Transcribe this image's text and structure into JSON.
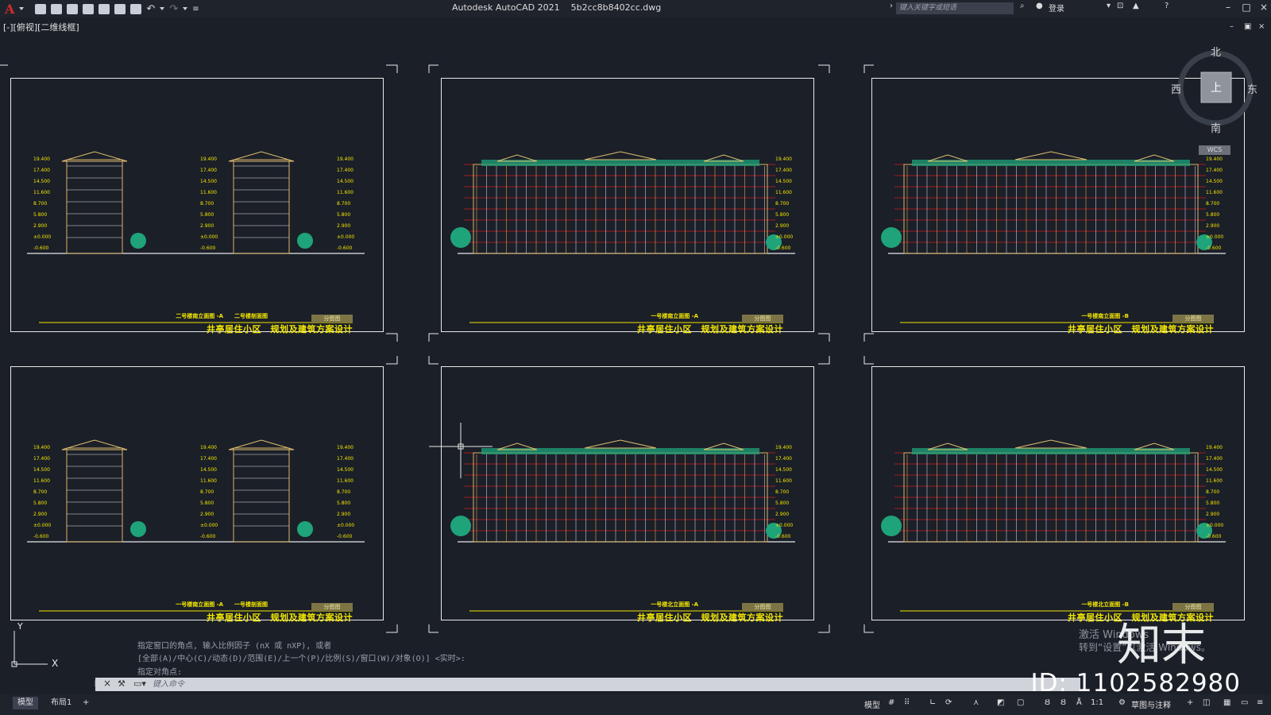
{
  "app": {
    "title": "Autodesk AutoCAD 2021",
    "filename": "5b2cc8b8402cc.dwg",
    "logo": "A"
  },
  "search": {
    "placeholder": "键入关键字或短语"
  },
  "account": {
    "login": "登录"
  },
  "viewport": {
    "label": "[-][俯视][二维线框]"
  },
  "sheets": [
    {
      "project": "井亭居住小区　规划及建筑方案设计",
      "caption": "二号楼南立面图 -A　　二号楼剖面图",
      "badge": "分图图",
      "levels": [
        "19.400",
        "17.400",
        "14.500",
        "11.600",
        "8.700",
        "5.800",
        "2.900",
        "±0.000",
        "-0.600"
      ]
    },
    {
      "project": "井亭居住小区　规划及建筑方案设计",
      "caption": "一号楼南立面图 -A",
      "badge": "分图图",
      "levels": [
        "19.400",
        "17.400",
        "14.500",
        "11.600",
        "8.700",
        "5.800",
        "2.900",
        "±0.000",
        "-0.600"
      ]
    },
    {
      "project": "井亭居住小区　规划及建筑方案设计",
      "caption": "一号楼南立面图 -B",
      "badge": "分图图",
      "levels": [
        "19.400",
        "17.400",
        "14.500",
        "11.600",
        "8.700",
        "5.800",
        "2.900",
        "±0.000",
        "-0.600"
      ]
    },
    {
      "project": "井亭居住小区　规划及建筑方案设计",
      "caption": "一号楼南立面图 -A　　一号楼剖面图",
      "badge": "分图图",
      "levels": [
        "19.400",
        "17.400",
        "14.500",
        "11.600",
        "8.700",
        "5.800",
        "2.900",
        "±0.000",
        "-0.600"
      ]
    },
    {
      "project": "井亭居住小区　规划及建筑方案设计",
      "caption": "一号楼北立面图 -A",
      "badge": "分图图",
      "levels": [
        "19.400",
        "17.400",
        "14.500",
        "11.600",
        "8.700",
        "5.800",
        "2.900",
        "±0.000",
        "-0.600"
      ]
    },
    {
      "project": "井亭居住小区　规划及建筑方案设计",
      "caption": "一号楼北立面图 -B",
      "badge": "分图图",
      "levels": [
        "19.400",
        "17.400",
        "14.500",
        "11.600",
        "8.700",
        "5.800",
        "2.900",
        "±0.000",
        "-0.600"
      ]
    }
  ],
  "viewcube": {
    "north": "北",
    "south": "南",
    "east": "东",
    "west": "西",
    "top": "上",
    "wcs": "WCS"
  },
  "command": {
    "history": [
      "指定窗口的角点, 输入比例因子 (nX 或 nXP), 或者",
      "[全部(A)/中心(C)/动态(D)/范围(E)/上一个(P)/比例(S)/窗口(W)/对象(O)] <实时>:",
      "指定对角点:"
    ],
    "placeholder": "键入命令"
  },
  "layout_tabs": [
    {
      "label": "模型",
      "active": true
    },
    {
      "label": "布局1",
      "active": false
    }
  ],
  "status": {
    "model": "模型",
    "scale": "1:1",
    "workspace": "草图与注释"
  },
  "overlay": {
    "activate1": "激活 Windows",
    "activate2": "转到“设置”以激活 Windows。",
    "logo": "知末",
    "id": "ID: 1102582980"
  },
  "colors": {
    "background": "#1b1f28",
    "sheet_border": "#e8e8e8",
    "title_yellow": "#f2e600",
    "level_red": "#d01c1c",
    "building_green": "#1fa37a"
  }
}
